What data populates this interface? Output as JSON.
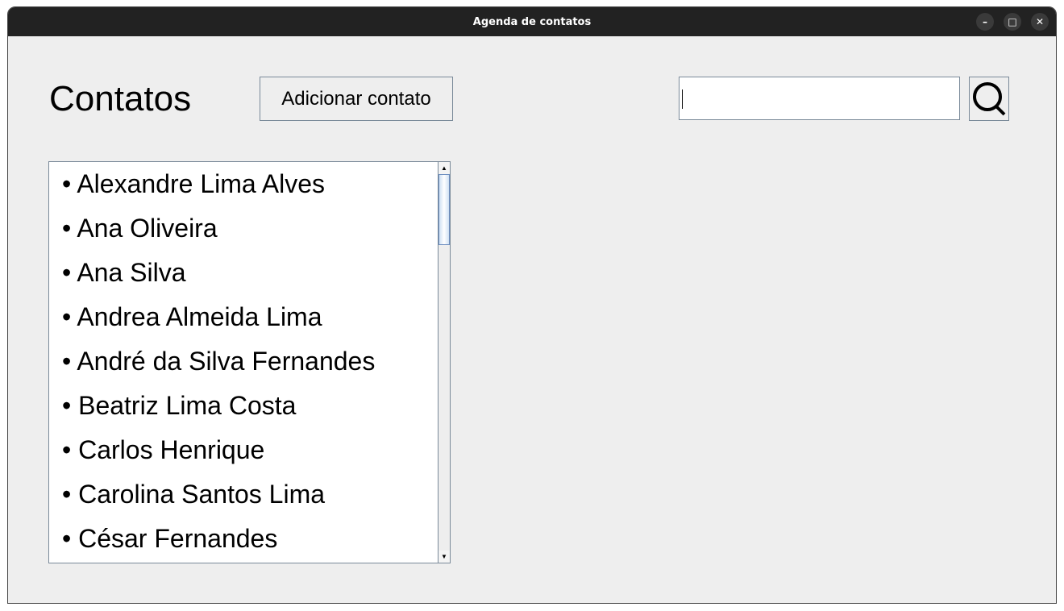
{
  "window": {
    "title": "Agenda de contatos"
  },
  "header": {
    "title": "Contatos",
    "add_label": "Adicionar contato",
    "search_value": ""
  },
  "contacts": [
    "Alexandre Lima Alves",
    "Ana Oliveira",
    "Ana Silva",
    "Andrea Almeida Lima",
    "André da Silva Fernandes",
    "Beatriz Lima Costa",
    "Carlos Henrique",
    "Carolina Santos Lima",
    "César Fernandes"
  ]
}
